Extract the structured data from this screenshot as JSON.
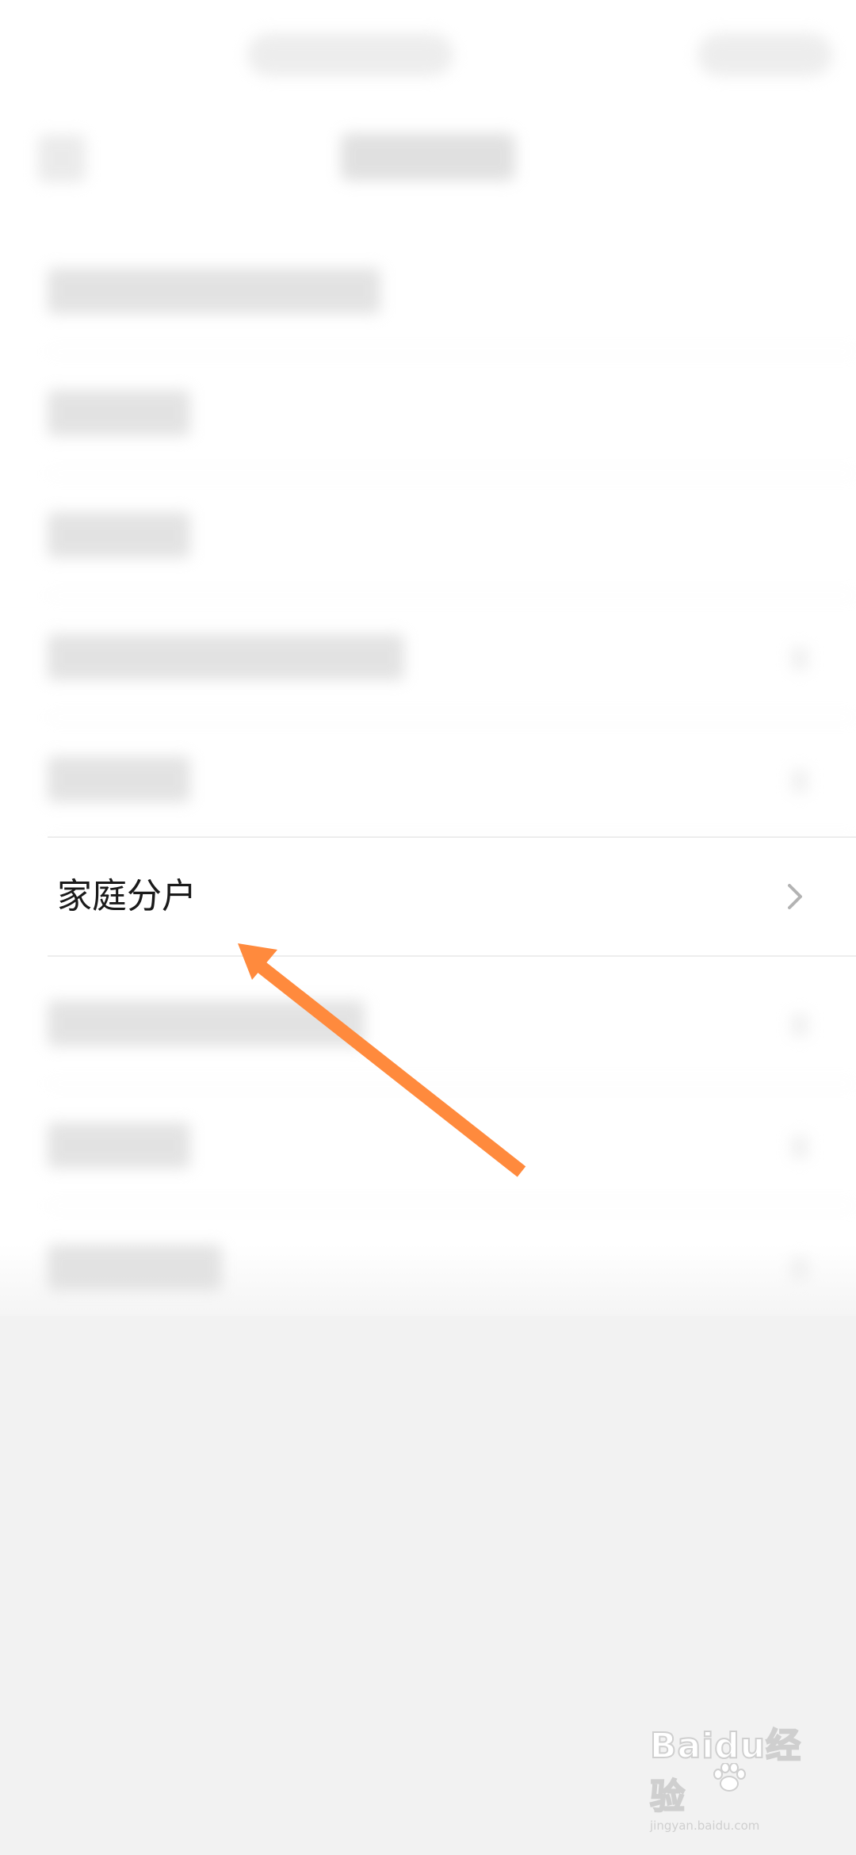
{
  "list": {
    "highlighted_item": {
      "label": "家庭分户"
    }
  },
  "watermark": {
    "brand": "Baidu经验",
    "url": "jingyan.baidu.com"
  },
  "annotation": {
    "arrow_color": "#ff8a3d"
  }
}
